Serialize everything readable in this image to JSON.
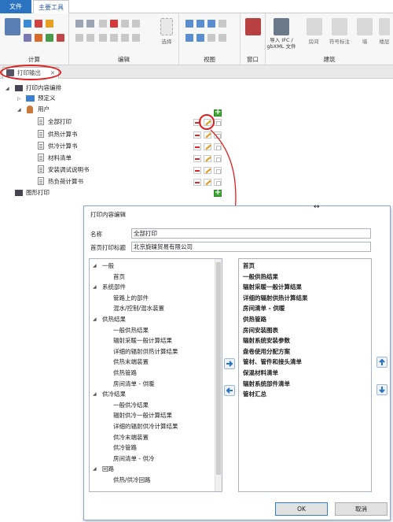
{
  "ribbon": {
    "tabs": {
      "file": "文件",
      "main": "主要工具"
    },
    "groups": {
      "calc": "计算",
      "edit": "编辑",
      "view": "视图",
      "window": "窗口",
      "building": "建筑"
    },
    "select_label": "选择",
    "import_ifc": "导入 IFC /\ngbXML 文件",
    "room": "房间",
    "symbol_mark": "符号标注",
    "wall": "墙",
    "floor": "楼层"
  },
  "doc_tab": {
    "label": "打印输出",
    "close": "✕"
  },
  "tree": {
    "root": "打印内容编排",
    "predefined": "预定义",
    "user": "用户",
    "items": [
      "全部打印",
      "供热计算书",
      "供冷计算书",
      "材料清单",
      "安装调试说明书",
      "热负荷计算书"
    ],
    "graphic_print": "图形打印"
  },
  "dialog": {
    "title": "打印内容编辑",
    "name_label": "名称",
    "name_value": "全部打印",
    "header_label": "首页打印标题",
    "header_value": "北京旋碟贸易有限公司",
    "left_list": [
      {
        "text": "一般",
        "level": 0
      },
      {
        "text": "首页",
        "level": 1
      },
      {
        "text": "系统部件",
        "level": 0
      },
      {
        "text": "管路上的部件",
        "level": 1
      },
      {
        "text": "混水/控制/混水装置",
        "level": 1
      },
      {
        "text": "供热结果",
        "level": 0
      },
      {
        "text": "一般供热结果",
        "level": 1
      },
      {
        "text": "辐射采暖一般计算结果",
        "level": 1
      },
      {
        "text": "详细的辐射供热计算结果",
        "level": 1
      },
      {
        "text": "供热末端装置",
        "level": 1
      },
      {
        "text": "供热管路",
        "level": 1
      },
      {
        "text": "房间清单 - 供暖",
        "level": 1
      },
      {
        "text": "供冷结果",
        "level": 0
      },
      {
        "text": "一般供冷结果",
        "level": 1
      },
      {
        "text": "辐射供冷一般计算结果",
        "level": 1
      },
      {
        "text": "详细的辐射供冷计算结果",
        "level": 1
      },
      {
        "text": "供冷末端装置",
        "level": 1
      },
      {
        "text": "供冷管路",
        "level": 1
      },
      {
        "text": "房间清单 - 供冷",
        "level": 1
      },
      {
        "text": "回路",
        "level": 0
      },
      {
        "text": "供热/供冷回路",
        "level": 1
      }
    ],
    "right_list": [
      "首页",
      "一般供热结果",
      "辐射采暖一般计算结果",
      "详细的辐射供热计算结果",
      "房间清单 - 供暖",
      "供热管路",
      "房间安装图表",
      "辐射系统安装参数",
      "盘卷使用分配方案",
      "管材、管件和接头清单",
      "保温材料清单",
      "辐射系统部件清单",
      "管材汇总"
    ],
    "ok": "OK",
    "cancel": "取消"
  },
  "colors": {
    "accent": "#2b73c1",
    "annotation": "#e02020",
    "add": "#3fa535",
    "remove": "#d8262a"
  }
}
